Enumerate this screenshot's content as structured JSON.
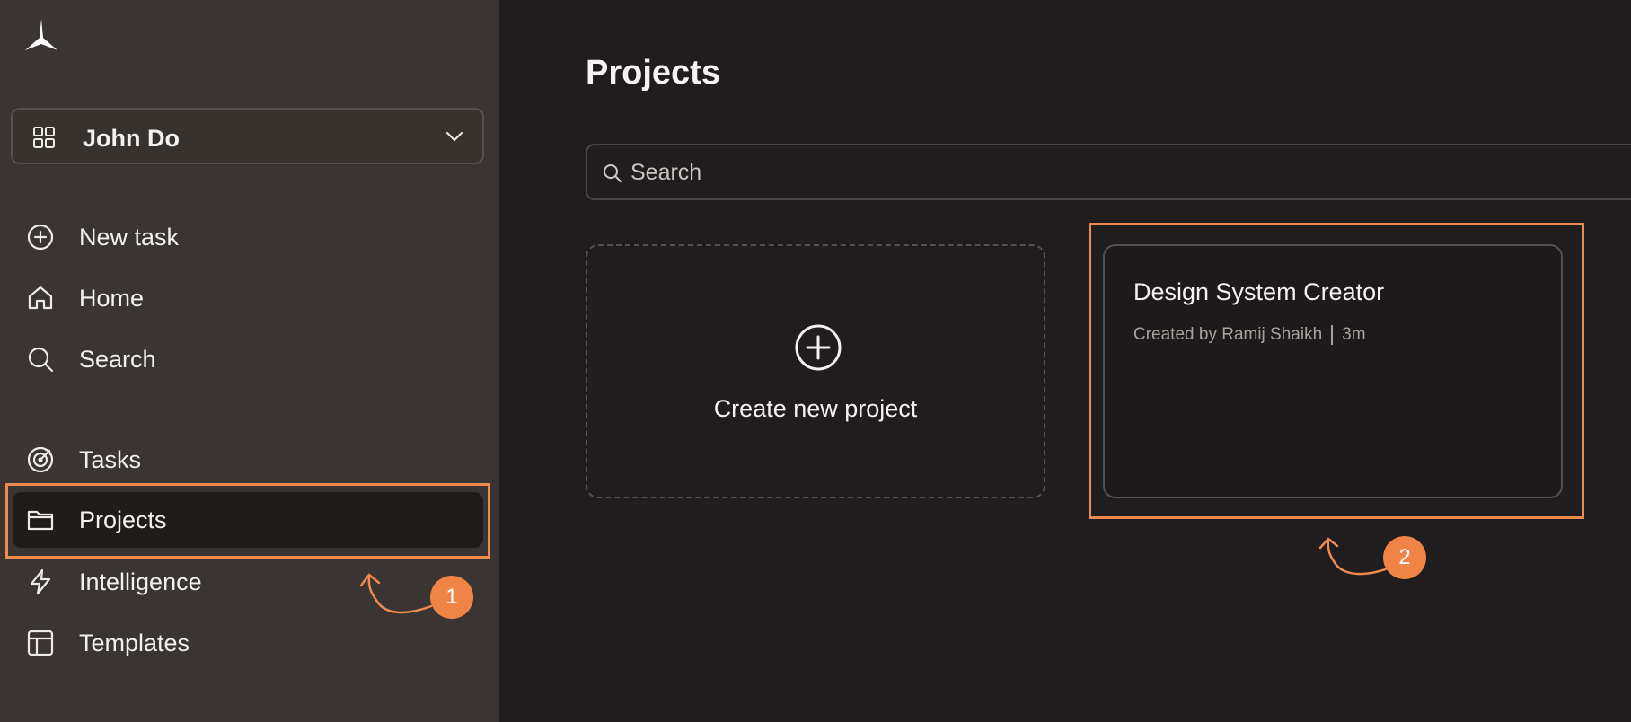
{
  "sidebar": {
    "workspace": {
      "name": "John Do"
    },
    "items": [
      {
        "id": "new-task",
        "label": "New task",
        "icon": "plus-circle-icon"
      },
      {
        "id": "home",
        "label": "Home",
        "icon": "home-icon"
      },
      {
        "id": "search",
        "label": "Search",
        "icon": "search-icon"
      },
      {
        "id": "tasks",
        "label": "Tasks",
        "icon": "target-icon"
      },
      {
        "id": "projects",
        "label": "Projects",
        "icon": "folder-icon",
        "active": true
      },
      {
        "id": "intelligence",
        "label": "Intelligence",
        "icon": "lightning-icon"
      },
      {
        "id": "templates",
        "label": "Templates",
        "icon": "layout-icon"
      }
    ]
  },
  "main": {
    "title": "Projects",
    "search": {
      "placeholder": "Search",
      "value": ""
    },
    "create_card": {
      "label": "Create new project"
    },
    "projects": [
      {
        "title": "Design System Creator",
        "created_by": "Created by Ramij Shaikh",
        "age": "3m"
      }
    ]
  },
  "annotations": [
    {
      "number": "1"
    },
    {
      "number": "2"
    }
  ],
  "colors": {
    "sidebar_bg": "#3a3432",
    "main_bg": "#1f1d1d",
    "accent": "#ef8a4f"
  }
}
